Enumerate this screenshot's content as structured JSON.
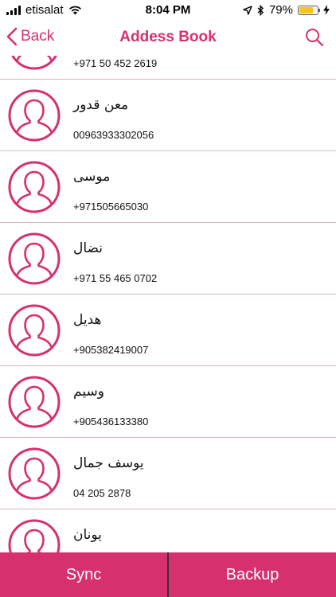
{
  "status_bar": {
    "carrier": "etisalat",
    "time": "8:04 PM",
    "battery_percent": "79%",
    "battery_level": 0.79
  },
  "nav": {
    "back_label": "Back",
    "title": "Addess Book"
  },
  "contacts": [
    {
      "name": "",
      "phone": "+971 50 452 2619"
    },
    {
      "name": "معن قدور",
      "phone": "00963933302056"
    },
    {
      "name": "موسى",
      "phone": "+971505665030"
    },
    {
      "name": "نضال",
      "phone": "+971 55 465 0702"
    },
    {
      "name": "هديل",
      "phone": "+905382419007"
    },
    {
      "name": "وسيم",
      "phone": "+905436133380"
    },
    {
      "name": "يوسف جمال",
      "phone": "04 205 2878"
    },
    {
      "name": "يونان",
      "phone": ""
    }
  ],
  "toolbar": {
    "sync_label": "Sync",
    "backup_label": "Backup"
  },
  "colors": {
    "accent": "#d6306f",
    "divider": "#d9b3c4"
  },
  "icons": [
    "signal-icon",
    "wifi-icon",
    "location-icon",
    "bluetooth-icon",
    "battery-icon",
    "charging-icon",
    "chevron-left-icon",
    "search-icon",
    "person-avatar-icon"
  ]
}
